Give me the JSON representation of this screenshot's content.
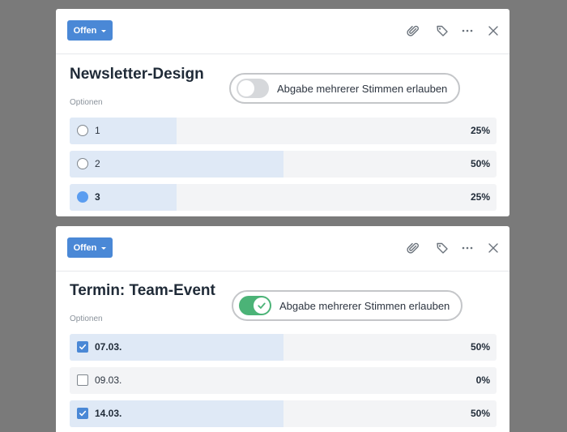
{
  "polls": [
    {
      "status_label": "Offen",
      "title": "Newsletter-Design",
      "toggle_label": "Abgabe mehrerer Stimmen erlauben",
      "toggle_on": false,
      "section_label": "Optionen",
      "options": [
        {
          "label": "1",
          "percent": "25%",
          "fraction": 0.25,
          "selected": false
        },
        {
          "label": "2",
          "percent": "50%",
          "fraction": 0.5,
          "selected": false
        },
        {
          "label": "3",
          "percent": "25%",
          "fraction": 0.25,
          "selected": true
        }
      ]
    },
    {
      "status_label": "Offen",
      "title": "Termin: Team-Event",
      "toggle_label": "Abgabe mehrerer Stimmen erlauben",
      "toggle_on": true,
      "section_label": "Optionen",
      "options": [
        {
          "label": "07.03.",
          "percent": "50%",
          "fraction": 0.5,
          "selected": true
        },
        {
          "label": "09.03.",
          "percent": "0%",
          "fraction": 0.0,
          "selected": false
        },
        {
          "label": "14.03.",
          "percent": "50%",
          "fraction": 0.5,
          "selected": true
        }
      ]
    }
  ],
  "icons": {
    "attach": "paperclip-icon",
    "tag": "tag-icon",
    "more": "more-dots-icon",
    "close": "close-icon"
  },
  "colors": {
    "status_button": "#4a88d6",
    "toggle_on": "#4bb377",
    "toggle_off": "#d6d8db",
    "option_fill": "#dfe9f6",
    "option_bg": "#f3f4f6",
    "radio_selected": "#5b9df0"
  }
}
